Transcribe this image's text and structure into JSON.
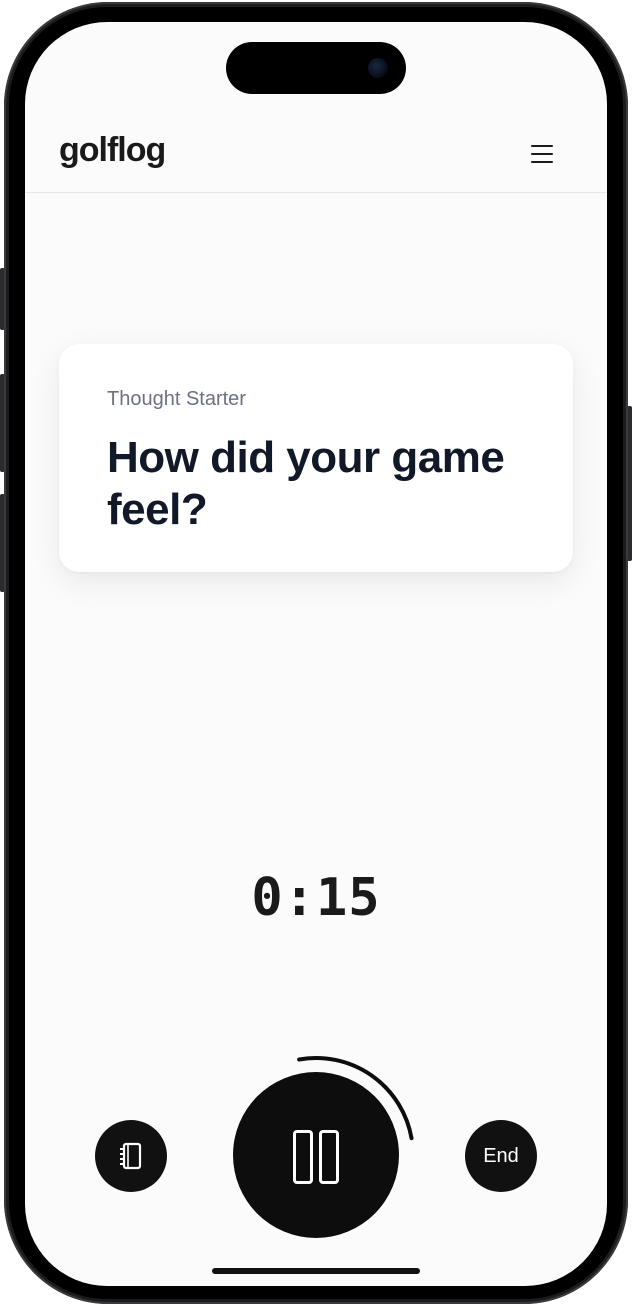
{
  "header": {
    "logo": "golflog",
    "menu_icon": "hamburger-menu-icon"
  },
  "card": {
    "label": "Thought Starter",
    "title": "How did your game feel?"
  },
  "timer": {
    "display": "0:15",
    "progress_fraction": 0.25
  },
  "controls": {
    "left_icon": "notebook-icon",
    "center_icon": "pause-icon",
    "end_label": "End"
  },
  "colors": {
    "background": "#fbfbfb",
    "accent": "#0d0d0d",
    "title": "#111827",
    "label": "#6b7280"
  }
}
